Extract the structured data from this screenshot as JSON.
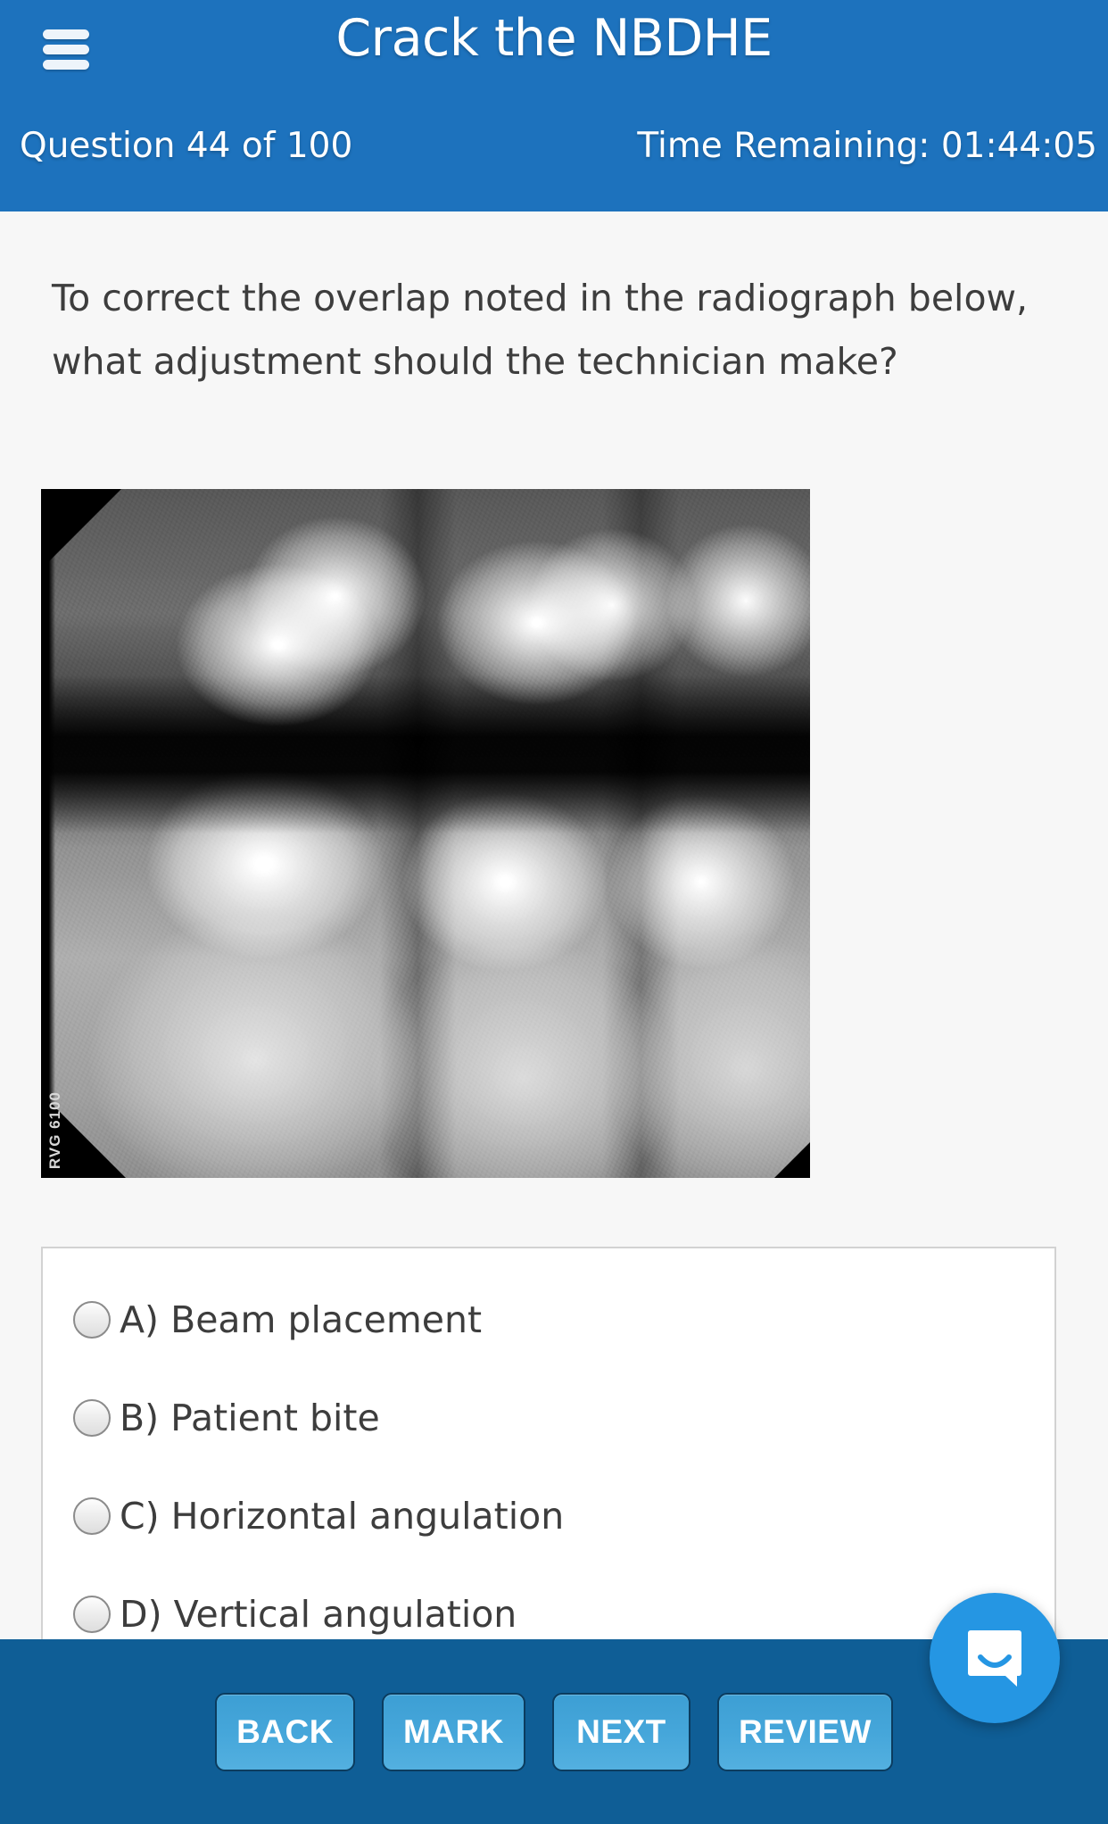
{
  "header": {
    "menu_icon": "hamburger-menu-icon",
    "app_title": "Crack the NBDHE",
    "question_counter": "Question 44 of 100",
    "time_remaining": "Time Remaining: 01:44:05",
    "bg_color": "#1d72bd"
  },
  "question": {
    "text": "To correct the overlap noted in the radiograph below, what adjustment should the technician make?"
  },
  "radiograph": {
    "alt": "Dental bitewing radiograph showing overlapped posterior teeth",
    "watermark": "RVG 6100"
  },
  "answers": {
    "options": [
      {
        "id": "A",
        "label": "A) Beam placement",
        "selected": false
      },
      {
        "id": "B",
        "label": "B) Patient bite",
        "selected": false
      },
      {
        "id": "C",
        "label": "C) Horizontal angulation",
        "selected": false
      },
      {
        "id": "D",
        "label": "D) Vertical angulation",
        "selected": false
      }
    ]
  },
  "footer": {
    "bg_color": "#0f5e96",
    "button_color": "#45a6da",
    "buttons": [
      {
        "id": "back",
        "label": "BACK"
      },
      {
        "id": "mark",
        "label": "MARK"
      },
      {
        "id": "next",
        "label": "NEXT"
      },
      {
        "id": "review",
        "label": "REVIEW"
      }
    ]
  },
  "chat": {
    "icon": "chat-bubble-icon",
    "color": "#2596e3"
  }
}
